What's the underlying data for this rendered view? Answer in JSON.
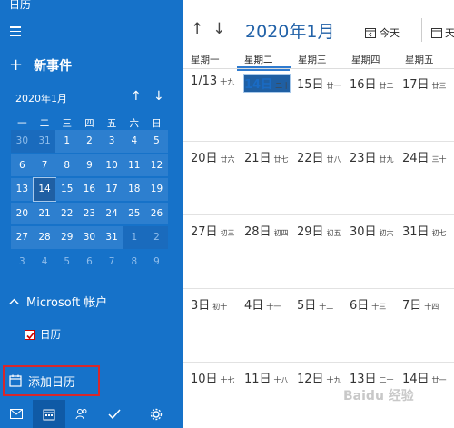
{
  "app_title": "日历",
  "sidebar": {
    "new_event": "新事件",
    "mini_calendar": {
      "month_label": "2020年1月",
      "weekday_headers": [
        "一",
        "二",
        "三",
        "四",
        "五",
        "六",
        "日"
      ],
      "weeks": [
        [
          "30",
          "31",
          "1",
          "2",
          "3",
          "4",
          "5"
        ],
        [
          "6",
          "7",
          "8",
          "9",
          "10",
          "11",
          "12"
        ],
        [
          "13",
          "14",
          "15",
          "16",
          "17",
          "18",
          "19"
        ],
        [
          "20",
          "21",
          "22",
          "23",
          "24",
          "25",
          "26"
        ],
        [
          "27",
          "28",
          "29",
          "30",
          "31",
          "1",
          "2"
        ],
        [
          "3",
          "4",
          "5",
          "6",
          "7",
          "8",
          "9"
        ]
      ],
      "today": "14"
    },
    "account_label": "Microsoft 帐户",
    "calendar_item": "日历",
    "add_calendar": "添加日历"
  },
  "main": {
    "title": "2020年1月",
    "today_button": "今天",
    "day_button": "天",
    "weekday_labels": [
      "星期一",
      "星期二",
      "星期三",
      "星期四",
      "星期五"
    ],
    "weeks": [
      [
        {
          "num": "1/13",
          "lunar": "十九"
        },
        {
          "num": "14日",
          "lunar": "二十"
        },
        {
          "num": "15日",
          "lunar": "廿一"
        },
        {
          "num": "16日",
          "lunar": "廿二"
        },
        {
          "num": "17日",
          "lunar": "廿三"
        }
      ],
      [
        {
          "num": "20日",
          "lunar": "廿六"
        },
        {
          "num": "21日",
          "lunar": "廿七"
        },
        {
          "num": "22日",
          "lunar": "廿八"
        },
        {
          "num": "23日",
          "lunar": "廿九"
        },
        {
          "num": "24日",
          "lunar": "三十"
        }
      ],
      [
        {
          "num": "27日",
          "lunar": "初三"
        },
        {
          "num": "28日",
          "lunar": "初四"
        },
        {
          "num": "29日",
          "lunar": "初五"
        },
        {
          "num": "30日",
          "lunar": "初六"
        },
        {
          "num": "31日",
          "lunar": "初七"
        }
      ],
      [
        {
          "num": "3日",
          "lunar": "初十"
        },
        {
          "num": "4日",
          "lunar": "十一"
        },
        {
          "num": "5日",
          "lunar": "十二"
        },
        {
          "num": "6日",
          "lunar": "十三"
        },
        {
          "num": "7日",
          "lunar": "十四"
        }
      ],
      [
        {
          "num": "10日",
          "lunar": "十七"
        },
        {
          "num": "11日",
          "lunar": "十八"
        },
        {
          "num": "12日",
          "lunar": "十九"
        },
        {
          "num": "13日",
          "lunar": "二十"
        },
        {
          "num": "14日",
          "lunar": "廿一"
        }
      ]
    ]
  },
  "watermark": "Baidu 经验",
  "colors": {
    "sidebar_bg": "#1672c9",
    "accent": "#2f7bcf",
    "highlight_border": "#d8272a"
  }
}
